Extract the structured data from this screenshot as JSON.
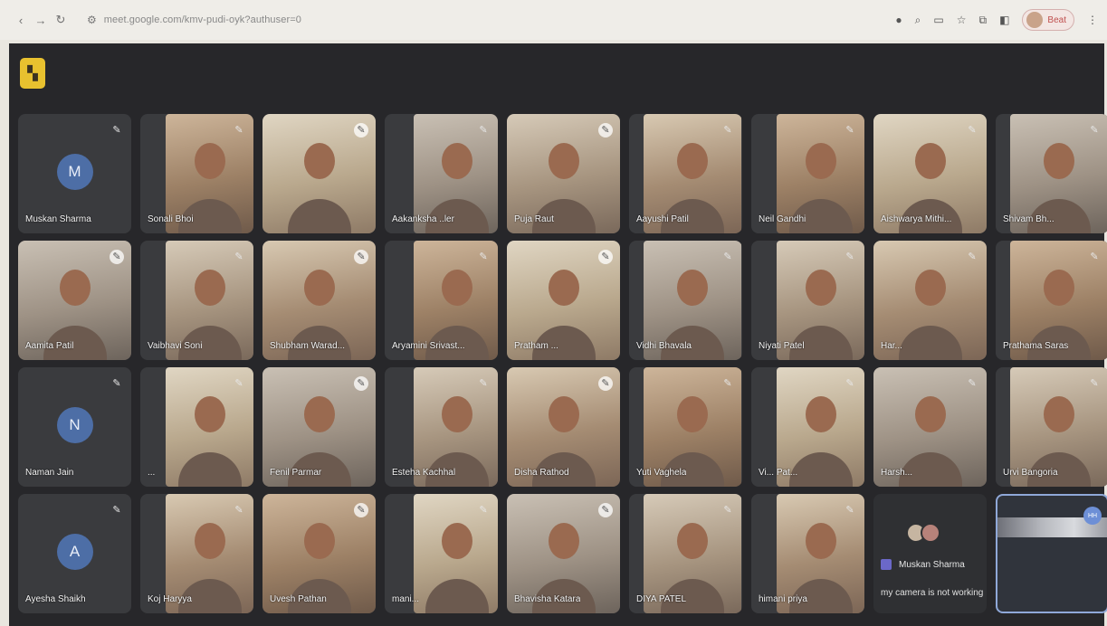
{
  "browser": {
    "url": "meet.google.com/kmv-pudi-oyk?authuser=0",
    "profile_label": "Beat",
    "icons": [
      "back-icon",
      "forward-icon",
      "reload-icon",
      "site-settings-icon",
      "camera-icon",
      "zoom-icon",
      "cast-icon",
      "bookmark-star-icon",
      "extensions-icon",
      "sidepanel-icon",
      "menu-icon"
    ]
  },
  "meet": {
    "colors": {
      "background": "#27272a",
      "tile": "#3a3b3e",
      "badge": "#e8c12f",
      "avatar": "#4d6ea6"
    },
    "rows": [
      [
        {
          "name": "Muskan Sharma",
          "avatar": "M",
          "video": false
        },
        {
          "name": "Sonali Bhoi",
          "video": true
        },
        {
          "name": "",
          "video": true
        },
        {
          "name": "Aakanksha ..ler",
          "video": true
        },
        {
          "name": "Puja Raut",
          "video": true
        },
        {
          "name": "Aayushi Patil",
          "video": true
        },
        {
          "name": "Neil Gandhi",
          "video": true
        },
        {
          "name": "Aishwarya Mithi...",
          "video": true
        },
        {
          "name": "Shivam Bh...",
          "video": true
        }
      ],
      [
        {
          "name": "Aamita Patil",
          "video": true
        },
        {
          "name": "Vaibhavi Soni",
          "video": true
        },
        {
          "name": "Shubham Warad...",
          "video": true
        },
        {
          "name": "Aryamini Srivast...",
          "video": true
        },
        {
          "name": "Pratham ...",
          "video": true
        },
        {
          "name": "Vidhi Bhavala",
          "video": true
        },
        {
          "name": "Niyati Patel",
          "video": true
        },
        {
          "name": "Har...",
          "video": true
        },
        {
          "name": "Prathama Saras",
          "video": true
        }
      ],
      [
        {
          "name": "Naman Jain",
          "avatar": "N",
          "video": false
        },
        {
          "name": "...",
          "video": true
        },
        {
          "name": "Fenil Parmar",
          "video": true
        },
        {
          "name": "Esteha Kachhal",
          "video": true
        },
        {
          "name": "Disha Rathod",
          "video": true
        },
        {
          "name": "Yuti Vaghela",
          "video": true
        },
        {
          "name": "Vi... Pat...",
          "video": true
        },
        {
          "name": "Harsh...",
          "video": true
        },
        {
          "name": "Urvi Bangoria",
          "video": true
        }
      ],
      [
        {
          "name": "Ayesha Shaikh",
          "avatar": "A",
          "video": false
        },
        {
          "name": "Koj Haryya",
          "video": true
        },
        {
          "name": "Uvesh Pathan",
          "video": true
        },
        {
          "name": "mani...",
          "video": true
        },
        {
          "name": "Bhavisha Katara",
          "video": true
        },
        {
          "name": "DIYA PATEL",
          "video": true
        },
        {
          "name": "himani priya",
          "video": true
        },
        {
          "type": "chat",
          "sender": "Muskan Sharma",
          "message": "my camera is not working"
        },
        {
          "type": "self",
          "badge": "HH"
        }
      ]
    ]
  }
}
